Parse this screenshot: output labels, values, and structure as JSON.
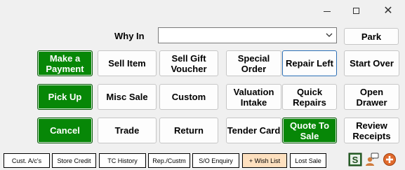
{
  "form": {
    "why_in_label": "Why In",
    "why_in_value": ""
  },
  "buttons": {
    "park": "Park",
    "make_payment": "Make a Payment",
    "sell_item": "Sell Item",
    "sell_gift_voucher": "Sell Gift Voucher",
    "special_order": "Special Order",
    "repair_left": "Repair Left",
    "start_over": "Start Over",
    "pick_up": "Pick Up",
    "misc_sale": "Misc Sale",
    "custom": "Custom",
    "valuation_intake": "Valuation Intake",
    "quick_repairs": "Quick Repairs",
    "open_drawer": "Open Drawer",
    "cancel": "Cancel",
    "trade": "Trade",
    "return": "Return",
    "tender_card": "Tender Card",
    "quote_to_sale": "Quote To Sale",
    "review_receipts": "Review Receipts"
  },
  "bottom_bar": {
    "cust_ac": "Cust. A/c's",
    "store_credit": "Store Credit",
    "tc_history": "TC History",
    "rep_custm": "Rep./Custm",
    "so_enquiry": "S/O Enquiry",
    "wish_list": "+ Wish List",
    "lost_sale": "Lost Sale"
  },
  "icons": {
    "s_badge_letter": "S"
  },
  "colors": {
    "green": "#078707",
    "wish_list_bg": "#fde0bf",
    "background": "#f0f0f0"
  }
}
